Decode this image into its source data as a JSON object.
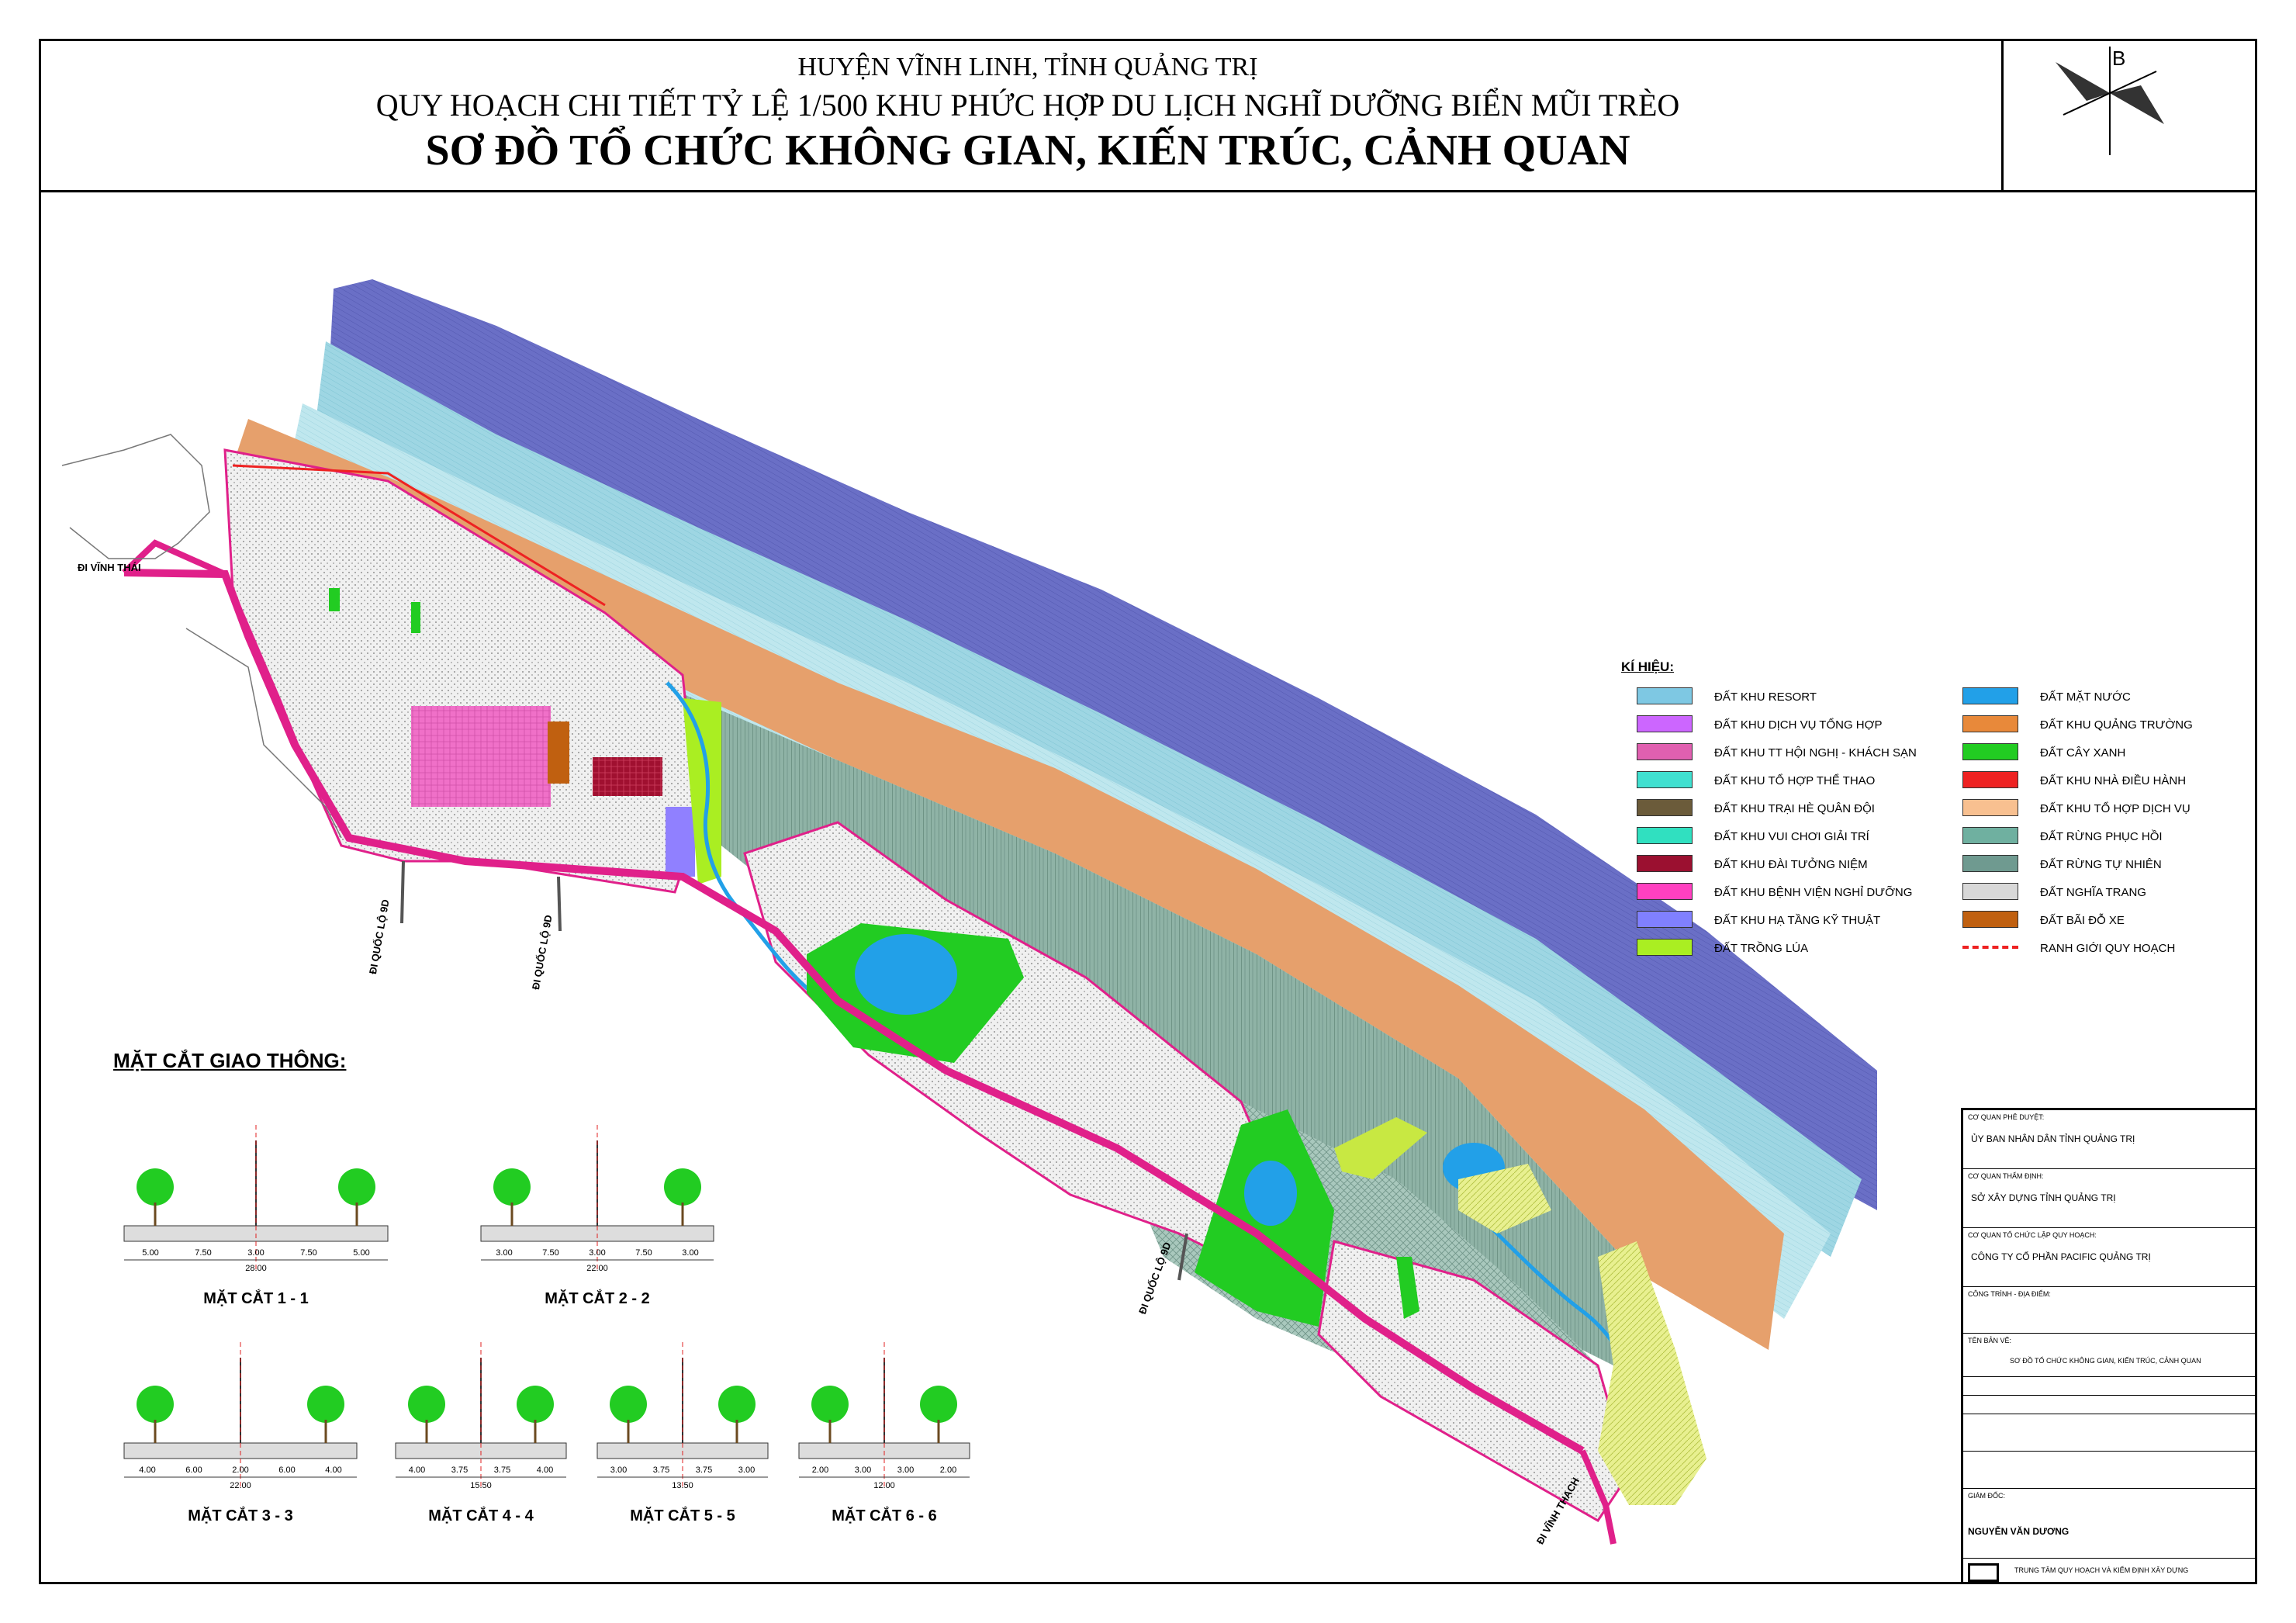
{
  "header": {
    "line1": "HUYỆN VĨNH LINH, TỈNH QUẢNG TRỊ",
    "line2": "QUY HOẠCH CHI TIẾT TỶ LỆ 1/500 KHU PHỨC HỢP DU LỊCH NGHĨ DƯỠNG BIỂN MŨI TRÈO",
    "line3": "SƠ ĐỒ TỔ CHỨC KHÔNG GIAN, KIẾN TRÚC, CẢNH QUAN"
  },
  "compass": {
    "letter": "B"
  },
  "road_labels": {
    "vinh_thai": "ĐI VĨNH THÁI",
    "ql9d_1": "ĐI QUỐC LỘ 9D",
    "ql9d_2": "ĐI QUỐC LỘ 9D",
    "ql9d_3": "ĐI QUỐC LỘ 9D",
    "vinh_thach": "ĐI VĨNH THẠCH"
  },
  "legend": {
    "title": "KÍ HIỆU:",
    "items_left": [
      {
        "label": "ĐẤT KHU RESORT",
        "color": "#7ec8e3"
      },
      {
        "label": "ĐẤT KHU DỊCH VỤ TỔNG HỢP",
        "color": "#cc66ff"
      },
      {
        "label": "ĐẤT KHU TT HỘI NGHỊ - KHÁCH SẠN",
        "color": "#e060b0"
      },
      {
        "label": "ĐẤT KHU TỔ HỢP THỂ THAO",
        "color": "#40e0d0"
      },
      {
        "label": "ĐẤT KHU TRẠI HÈ QUÂN ĐỘI",
        "color": "#6b5b3a"
      },
      {
        "label": "ĐẤT KHU VUI CHƠI GIẢI TRÍ",
        "color": "#30e0c0"
      },
      {
        "label": "ĐẤT KHU ĐÀI TƯỞNG NIỆM",
        "color": "#9b1030"
      },
      {
        "label": "ĐẤT KHU BỆNH VIỆN NGHỈ DƯỠNG",
        "color": "#ff40c0"
      },
      {
        "label": "ĐẤT KHU HẠ TẦNG KỸ THUẬT",
        "color": "#8080ff"
      },
      {
        "label": "ĐẤT TRỒNG LÚA",
        "color": "#aaee22"
      }
    ],
    "items_right": [
      {
        "label": "ĐẤT MẶT NƯỚC",
        "color": "#22a0e8"
      },
      {
        "label": "ĐẤT KHU QUẢNG TRƯỜNG",
        "color": "#e8893a"
      },
      {
        "label": "ĐẤT CÂY XANH",
        "color": "#22cc22"
      },
      {
        "label": "ĐẤT KHU NHÀ ĐIỀU HÀNH",
        "color": "#ee2222"
      },
      {
        "label": "ĐẤT KHU TỔ HỢP DỊCH VỤ",
        "color": "#f8c090"
      },
      {
        "label": "ĐẤT RỪNG PHỤC HỒI",
        "color": "#6fb0a0"
      },
      {
        "label": "ĐẤT RỪNG TỰ NHIÊN",
        "color": "#6f9a90"
      },
      {
        "label": "ĐẤT NGHĨA TRANG",
        "color": "#d8d8d8"
      },
      {
        "label": "ĐẤT BÃI ĐỖ XE",
        "color": "#c06010"
      },
      {
        "label": "RANH GIỚI QUY HOẠCH",
        "color": "#ee2222"
      }
    ]
  },
  "sections": {
    "title": "MẶT CẮT GIAO THÔNG:",
    "items": [
      {
        "name": "MẶT CẮT 1 - 1",
        "dims": [
          "5.00",
          "7.50",
          "3.00",
          "7.50",
          "5.00"
        ],
        "total": "28.00"
      },
      {
        "name": "MẶT CẮT 2 - 2",
        "dims": [
          "3.00",
          "7.50",
          "3.00",
          "7.50",
          "3.00"
        ],
        "total": "22.00"
      },
      {
        "name": "MẶT CẮT 3 - 3",
        "dims": [
          "4.00",
          "6.00",
          "2.00",
          "6.00",
          "4.00"
        ],
        "total": "22.00"
      },
      {
        "name": "MẶT CẮT 4 - 4",
        "dims": [
          "4.00",
          "3.75",
          "3.75",
          "4.00"
        ],
        "total": "15.50"
      },
      {
        "name": "MẶT CẮT 5 - 5",
        "dims": [
          "3.00",
          "3.75",
          "3.75",
          "3.00"
        ],
        "total": "13.50"
      },
      {
        "name": "MẶT CẮT 6 - 6",
        "dims": [
          "2.00",
          "3.00",
          "3.00",
          "2.00"
        ],
        "total": "12.00"
      }
    ]
  },
  "titleblock": {
    "approve_label": "CƠ QUAN PHÊ DUYỆT:",
    "approve_org": "ỦY BAN NHÂN DÂN TỈNH QUẢNG TRỊ",
    "appraise_label": "CƠ QUAN THẨM ĐỊNH:",
    "appraise_org": "SỞ XÂY DỰNG TỈNH QUẢNG TRỊ",
    "organize_label": "CƠ QUAN TỔ CHỨC LẬP QUY HOẠCH:",
    "organize_org": "CÔNG TY CỔ PHẦN PACIFIC QUẢNG TRỊ",
    "project_label": "CÔNG TRÌNH - ĐỊA ĐIỂM:",
    "drawing_label": "TÊN BẢN VẼ:",
    "drawing_name": "SƠ ĐỒ TỔ CHỨC KHÔNG GIAN, KIẾN TRÚC, CẢNH QUAN",
    "director_label": "GIÁM ĐỐC:",
    "director_name": "NGUYỄN VĂN DƯƠNG",
    "consultant": "TRUNG TÂM QUY HOẠCH VÀ KIỂM ĐỊNH XÂY DỰNG"
  }
}
